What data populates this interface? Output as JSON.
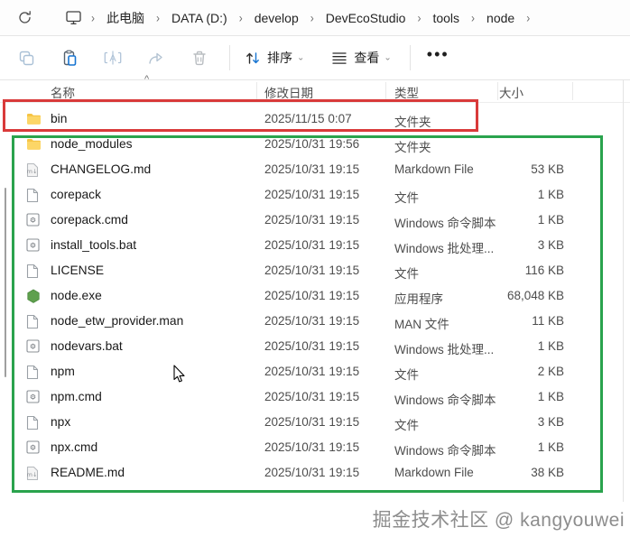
{
  "breadcrumb": {
    "items": [
      "此电脑",
      "DATA (D:)",
      "develop",
      "DevEcoStudio",
      "tools",
      "node"
    ],
    "separator": "›",
    "icons": [
      "refresh-icon",
      "monitor-icon"
    ]
  },
  "toolbar": {
    "sort_label": "排序",
    "view_label": "查看",
    "more_label": "•••",
    "icons": [
      "copy-icon",
      "paste-icon",
      "rename-icon",
      "share-icon",
      "delete-icon",
      "sort-arrows-icon",
      "view-lines-icon"
    ],
    "accent_blue": "#1674d1"
  },
  "columns": {
    "name": "名称",
    "date": "修改日期",
    "type": "类型",
    "size": "大小",
    "sort_indicator": "^"
  },
  "files": [
    {
      "name": "bin",
      "icon": "folder-icon",
      "date": "2025/11/15 0:07",
      "type": "文件夹",
      "size": ""
    },
    {
      "name": "node_modules",
      "icon": "folder-icon",
      "date": "2025/10/31 19:56",
      "type": "文件夹",
      "size": ""
    },
    {
      "name": "CHANGELOG.md",
      "icon": "md-icon",
      "date": "2025/10/31 19:15",
      "type": "Markdown File",
      "size": "53 KB"
    },
    {
      "name": "corepack",
      "icon": "file-icon",
      "date": "2025/10/31 19:15",
      "type": "文件",
      "size": "1 KB"
    },
    {
      "name": "corepack.cmd",
      "icon": "cmd-icon",
      "date": "2025/10/31 19:15",
      "type": "Windows 命令脚本",
      "size": "1 KB"
    },
    {
      "name": "install_tools.bat",
      "icon": "cmd-icon",
      "date": "2025/10/31 19:15",
      "type": "Windows 批处理...",
      "size": "3 KB"
    },
    {
      "name": "LICENSE",
      "icon": "file-icon",
      "date": "2025/10/31 19:15",
      "type": "文件",
      "size": "116 KB"
    },
    {
      "name": "node.exe",
      "icon": "node-icon",
      "date": "2025/10/31 19:15",
      "type": "应用程序",
      "size": "68,048 KB"
    },
    {
      "name": "node_etw_provider.man",
      "icon": "file-icon",
      "date": "2025/10/31 19:15",
      "type": "MAN 文件",
      "size": "11 KB"
    },
    {
      "name": "nodevars.bat",
      "icon": "cmd-icon",
      "date": "2025/10/31 19:15",
      "type": "Windows 批处理...",
      "size": "1 KB"
    },
    {
      "name": "npm",
      "icon": "file-icon",
      "date": "2025/10/31 19:15",
      "type": "文件",
      "size": "2 KB"
    },
    {
      "name": "npm.cmd",
      "icon": "cmd-icon",
      "date": "2025/10/31 19:15",
      "type": "Windows 命令脚本",
      "size": "1 KB"
    },
    {
      "name": "npx",
      "icon": "file-icon",
      "date": "2025/10/31 19:15",
      "type": "文件",
      "size": "3 KB"
    },
    {
      "name": "npx.cmd",
      "icon": "cmd-icon",
      "date": "2025/10/31 19:15",
      "type": "Windows 命令脚本",
      "size": "1 KB"
    },
    {
      "name": "README.md",
      "icon": "md-icon",
      "date": "2025/10/31 19:15",
      "type": "Markdown File",
      "size": "38 KB"
    }
  ],
  "annotations": {
    "red_highlight_color": "#d93a3a",
    "green_highlight_color": "#2aa34d",
    "red_highlight_target": "bin",
    "watermark": "掘金技术社区 @ kangyouwei"
  }
}
